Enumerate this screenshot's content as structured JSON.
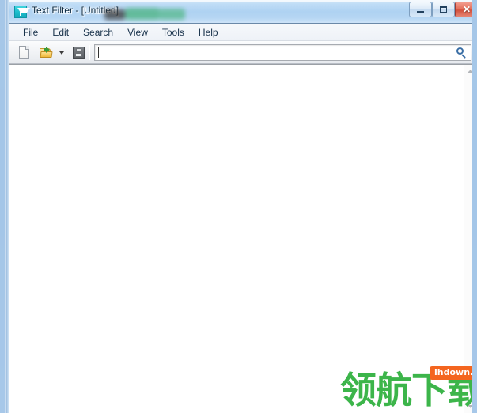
{
  "window": {
    "title": "Text Filter - [Untitled]",
    "app_icon": "funnel-filter-icon",
    "accent_color": "#1bbccb",
    "titlebar_color": "#aed2f2",
    "controls": {
      "minimize_label": "—",
      "maximize_label": "□",
      "close_label": "✕"
    }
  },
  "menu": {
    "items": [
      {
        "label": "File"
      },
      {
        "label": "Edit"
      },
      {
        "label": "Search"
      },
      {
        "label": "View"
      },
      {
        "label": "Tools"
      },
      {
        "label": "Help"
      }
    ]
  },
  "toolbar": {
    "new_label": "New",
    "new_icon": "new-document-icon",
    "open_label": "Open",
    "open_icon": "open-folder-icon",
    "open_dropdown_icon": "chevron-down-icon",
    "save_label": "Save",
    "save_icon": "floppy-disk-save-icon",
    "search": {
      "value": "",
      "placeholder": "",
      "icon": "search-magnifier-icon",
      "icon_color": "#3a6ea5"
    }
  },
  "editor": {
    "content": "",
    "placeholder": ""
  },
  "scrollbar": {
    "up_icon": "scroll-up-arrow-icon",
    "down_icon": "scroll-down-arrow-icon"
  },
  "watermark": {
    "text": "领航下载",
    "badge": "lhdown.com",
    "text_color": "#3cb54a",
    "badge_color": "#f4651f"
  }
}
